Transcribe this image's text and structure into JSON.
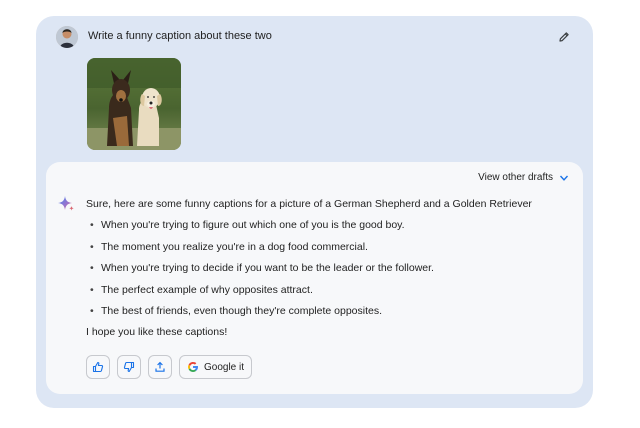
{
  "prompt": {
    "text": "Write a funny caption about these two",
    "avatar_icon": "user-avatar",
    "edit_icon": "pencil-icon"
  },
  "response": {
    "drafts_label": "View other drafts",
    "intro": "Sure, here are some funny captions for a picture of a German Shepherd and a Golden Retriever",
    "captions": [
      "When you're trying to figure out which one of you is the good boy.",
      "The moment you realize you're in a dog food commercial.",
      "When you're trying to decide if you want to be the leader or the follower.",
      "The perfect example of why opposites attract.",
      "The best of friends, even though they're complete opposites."
    ],
    "outro": "I hope you like these captions!"
  },
  "actions": {
    "thumbs_up_icon": "thumbs-up-icon",
    "thumbs_down_icon": "thumbs-down-icon",
    "share_icon": "share-icon",
    "google_label": "Google it"
  },
  "colors": {
    "panel_bg": "#dde6f4",
    "response_bg": "#f7f8fa",
    "accent_blue": "#1a73e8"
  }
}
